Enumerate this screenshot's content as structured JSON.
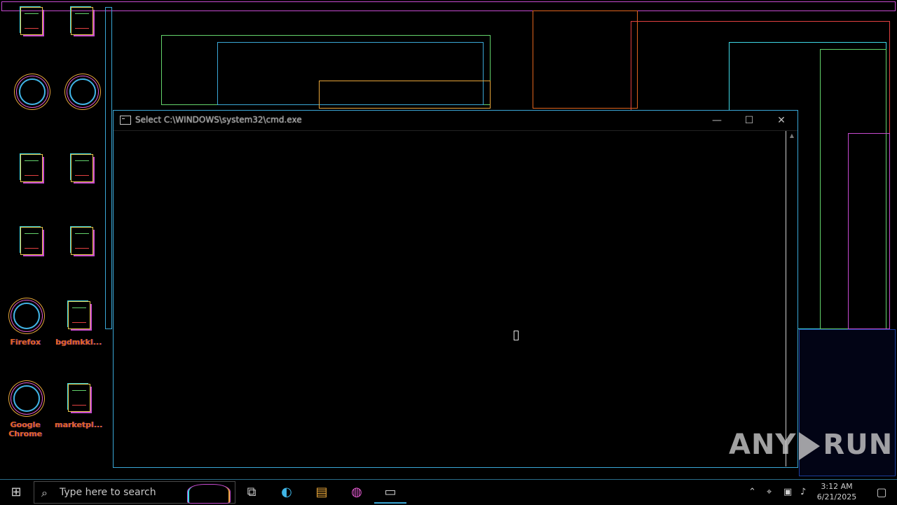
{
  "desktop": {
    "icons": [
      {
        "label": "Firefox",
        "kind": "circle"
      },
      {
        "label": "bgdmkkl...",
        "kind": "file"
      },
      {
        "label": "Google Chrome",
        "kind": "circle"
      },
      {
        "label": "marketpl...",
        "kind": "file"
      }
    ]
  },
  "cmd_window": {
    "title": "Select C:\\WINDOWS\\system32\\cmd.exe",
    "minimize_glyph": "—",
    "maximize_glyph": "☐",
    "close_glyph": "✕",
    "icon": "console-icon"
  },
  "watermark": {
    "left": "ANY",
    "right": "RUN"
  },
  "taskbar": {
    "search_placeholder": "Type here to search",
    "start_icon": "windows-logo-icon",
    "apps": [
      {
        "name": "task-view",
        "glyph": "⧉"
      },
      {
        "name": "edge",
        "glyph": "◐"
      },
      {
        "name": "file-explorer",
        "glyph": "▤"
      },
      {
        "name": "firefox",
        "glyph": "◍"
      },
      {
        "name": "cmd",
        "glyph": "▭"
      }
    ],
    "tray_icons": [
      "chevron-up-icon",
      "network-icon",
      "chat-icon",
      "volume-icon"
    ],
    "clock_time": "3:12 AM",
    "clock_date": "6/21/2025",
    "notification_icon": "notification-icon"
  },
  "colors": {
    "accent": "#3aa7d6",
    "icon_label": "#e0641e"
  }
}
